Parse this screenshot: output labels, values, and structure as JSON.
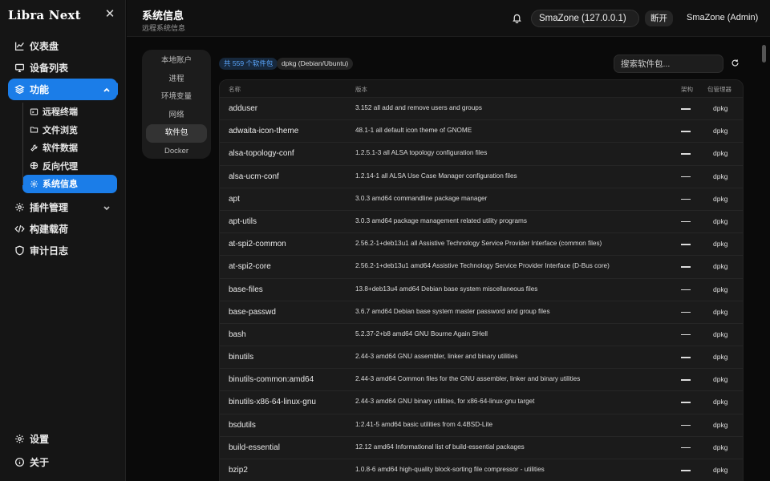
{
  "sidebar": {
    "brand": "Libra Next",
    "items": [
      {
        "label": "仪表盘",
        "icon": "chart-icon"
      },
      {
        "label": "设备列表",
        "icon": "monitor-icon"
      },
      {
        "label": "功能",
        "icon": "layers-icon"
      }
    ],
    "sub_items": [
      {
        "label": "远程终端",
        "icon": "terminal-icon"
      },
      {
        "label": "文件浏览",
        "icon": "folder-icon"
      },
      {
        "label": "软件数据",
        "icon": "tool-icon"
      },
      {
        "label": "反向代理",
        "icon": "globe-icon"
      },
      {
        "label": "系统信息",
        "icon": "gear-icon"
      }
    ],
    "items_after": [
      {
        "label": "插件管理",
        "icon": "gear-icon"
      },
      {
        "label": "构建载荷",
        "icon": "code-icon"
      },
      {
        "label": "审计日志",
        "icon": "shield-icon"
      }
    ],
    "bottom": [
      {
        "label": "设置",
        "icon": "gear-icon"
      },
      {
        "label": "关于",
        "icon": "info-icon"
      }
    ]
  },
  "header": {
    "title": "系统信息",
    "subtitle": "远程系统信息",
    "server": "SmaZone (127.0.0.1)",
    "disconnect": "断开",
    "user": "SmaZone (Admin)"
  },
  "submenu": [
    "本地账户",
    "进程",
    "环境变量",
    "网络",
    "软件包",
    "Docker"
  ],
  "toolbar": {
    "count_badge": "共 559 个软件包",
    "type_badge": "dpkg (Debian/Ubuntu)",
    "search_placeholder": "搜索软件包..."
  },
  "table": {
    "headers": [
      "名称",
      "版本",
      "架构",
      "包管理器"
    ],
    "rows": [
      {
        "name": "adduser",
        "version": "3.152 all add and remove users and groups",
        "manager": "dpkg"
      },
      {
        "name": "adwaita-icon-theme",
        "version": "48.1-1 all default icon theme of GNOME",
        "manager": "dpkg"
      },
      {
        "name": "alsa-topology-conf",
        "version": "1.2.5.1-3 all ALSA topology configuration files",
        "manager": "dpkg"
      },
      {
        "name": "alsa-ucm-conf",
        "version": "1.2.14-1 all ALSA Use Case Manager configuration files",
        "manager": "dpkg"
      },
      {
        "name": "apt",
        "version": "3.0.3 amd64 commandline package manager",
        "manager": "dpkg"
      },
      {
        "name": "apt-utils",
        "version": "3.0.3 amd64 package management related utility programs",
        "manager": "dpkg"
      },
      {
        "name": "at-spi2-common",
        "version": "2.56.2-1+deb13u1 all Assistive Technology Service Provider Interface (common files)",
        "manager": "dpkg"
      },
      {
        "name": "at-spi2-core",
        "version": "2.56.2-1+deb13u1 amd64 Assistive Technology Service Provider Interface (D-Bus core)",
        "manager": "dpkg"
      },
      {
        "name": "base-files",
        "version": "13.8+deb13u4 amd64 Debian base system miscellaneous files",
        "manager": "dpkg"
      },
      {
        "name": "base-passwd",
        "version": "3.6.7 amd64 Debian base system master password and group files",
        "manager": "dpkg"
      },
      {
        "name": "bash",
        "version": "5.2.37-2+b8 amd64 GNU Bourne Again SHell",
        "manager": "dpkg"
      },
      {
        "name": "binutils",
        "version": "2.44-3 amd64 GNU assembler, linker and binary utilities",
        "manager": "dpkg"
      },
      {
        "name": "binutils-common:amd64",
        "version": "2.44-3 amd64 Common files for the GNU assembler, linker and binary utilities",
        "manager": "dpkg"
      },
      {
        "name": "binutils-x86-64-linux-gnu",
        "version": "2.44-3 amd64 GNU binary utilities, for x86-64-linux-gnu target",
        "manager": "dpkg"
      },
      {
        "name": "bsdutils",
        "version": "1:2.41-5 amd64 basic utilities from 4.4BSD-Lite",
        "manager": "dpkg"
      },
      {
        "name": "build-essential",
        "version": "12.12 amd64 Informational list of build-essential packages",
        "manager": "dpkg"
      },
      {
        "name": "bzip2",
        "version": "1.0.8-6 amd64 high-quality block-sorting file compressor - utilities",
        "manager": "dpkg"
      }
    ]
  },
  "colors": {
    "accent": "#1b7de8",
    "background": "#0a0a0a",
    "sidebar": "#151515"
  }
}
